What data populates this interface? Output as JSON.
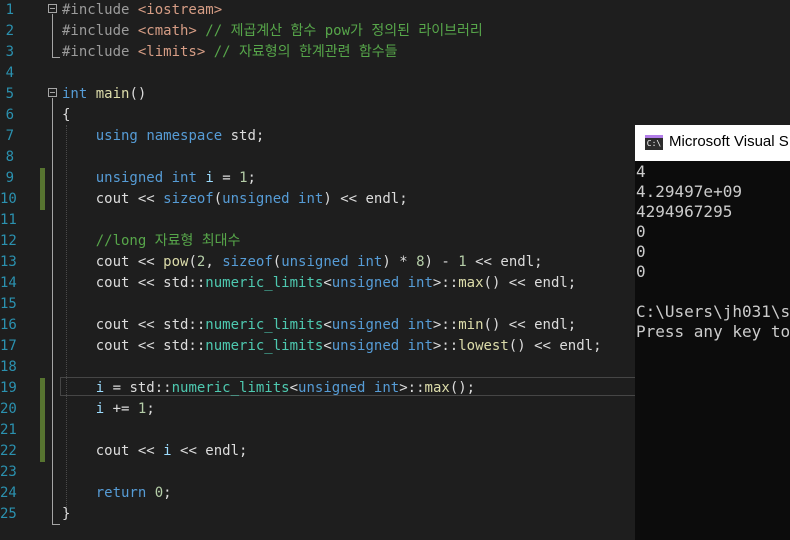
{
  "editor": {
    "line_numbers": [
      "1",
      "2",
      "3",
      "4",
      "5",
      "6",
      "7",
      "8",
      "9",
      "10",
      "11",
      "12",
      "13",
      "14",
      "15",
      "16",
      "17",
      "18",
      "19",
      "20",
      "21",
      "22",
      "23",
      "24",
      "25"
    ],
    "lines": [
      [
        {
          "t": "#include ",
          "c": "pp"
        },
        {
          "t": "<iostream>",
          "c": "str"
        }
      ],
      [
        {
          "t": "#include ",
          "c": "pp"
        },
        {
          "t": "<cmath>",
          "c": "str"
        },
        {
          "t": " // 제곱계산 함수 pow가 정의된 라이브러리",
          "c": "cm"
        }
      ],
      [
        {
          "t": "#include ",
          "c": "pp"
        },
        {
          "t": "<limits>",
          "c": "str"
        },
        {
          "t": " // 자료형의 한계관련 함수들",
          "c": "cm"
        }
      ],
      [],
      [
        {
          "t": "int",
          "c": "kw"
        },
        {
          "t": " "
        },
        {
          "t": "main",
          "c": "fn"
        },
        {
          "t": "()"
        }
      ],
      [
        {
          "t": "{"
        }
      ],
      [
        {
          "t": "    "
        },
        {
          "t": "using",
          "c": "kw"
        },
        {
          "t": " "
        },
        {
          "t": "namespace",
          "c": "kw"
        },
        {
          "t": " std;"
        }
      ],
      [],
      [
        {
          "t": "    "
        },
        {
          "t": "unsigned",
          "c": "kw"
        },
        {
          "t": " "
        },
        {
          "t": "int",
          "c": "kw"
        },
        {
          "t": " "
        },
        {
          "t": "i",
          "c": "var"
        },
        {
          "t": " = "
        },
        {
          "t": "1",
          "c": "num"
        },
        {
          "t": ";"
        }
      ],
      [
        {
          "t": "    cout << "
        },
        {
          "t": "sizeof",
          "c": "kw"
        },
        {
          "t": "("
        },
        {
          "t": "unsigned",
          "c": "kw"
        },
        {
          "t": " "
        },
        {
          "t": "int",
          "c": "kw"
        },
        {
          "t": ") << endl;"
        }
      ],
      [],
      [
        {
          "t": "    "
        },
        {
          "t": "//long 자료형 최대수",
          "c": "cm"
        }
      ],
      [
        {
          "t": "    cout << "
        },
        {
          "t": "pow",
          "c": "fn"
        },
        {
          "t": "("
        },
        {
          "t": "2",
          "c": "num"
        },
        {
          "t": ", "
        },
        {
          "t": "sizeof",
          "c": "kw"
        },
        {
          "t": "("
        },
        {
          "t": "unsigned",
          "c": "kw"
        },
        {
          "t": " "
        },
        {
          "t": "int",
          "c": "kw"
        },
        {
          "t": ") * "
        },
        {
          "t": "8",
          "c": "num"
        },
        {
          "t": ") - "
        },
        {
          "t": "1",
          "c": "num"
        },
        {
          "t": " << endl;"
        }
      ],
      [
        {
          "t": "    cout << std::"
        },
        {
          "t": "numeric_limits",
          "c": "ty"
        },
        {
          "t": "<"
        },
        {
          "t": "unsigned",
          "c": "kw"
        },
        {
          "t": " "
        },
        {
          "t": "int",
          "c": "kw"
        },
        {
          "t": ">::"
        },
        {
          "t": "max",
          "c": "fn"
        },
        {
          "t": "() << endl;"
        }
      ],
      [],
      [
        {
          "t": "    cout << std::"
        },
        {
          "t": "numeric_limits",
          "c": "ty"
        },
        {
          "t": "<"
        },
        {
          "t": "unsigned",
          "c": "kw"
        },
        {
          "t": " "
        },
        {
          "t": "int",
          "c": "kw"
        },
        {
          "t": ">::"
        },
        {
          "t": "min",
          "c": "fn"
        },
        {
          "t": "() << endl;"
        }
      ],
      [
        {
          "t": "    cout << std::"
        },
        {
          "t": "numeric_limits",
          "c": "ty"
        },
        {
          "t": "<"
        },
        {
          "t": "unsigned",
          "c": "kw"
        },
        {
          "t": " "
        },
        {
          "t": "int",
          "c": "kw"
        },
        {
          "t": ">::"
        },
        {
          "t": "lowest",
          "c": "fn"
        },
        {
          "t": "() << endl;"
        }
      ],
      [],
      [
        {
          "t": "    "
        },
        {
          "t": "i",
          "c": "var"
        },
        {
          "t": " = std::"
        },
        {
          "t": "numeric_limits",
          "c": "ty"
        },
        {
          "t": "<"
        },
        {
          "t": "unsigned",
          "c": "kw"
        },
        {
          "t": " "
        },
        {
          "t": "int",
          "c": "kw"
        },
        {
          "t": ">::"
        },
        {
          "t": "max",
          "c": "fn"
        },
        {
          "t": "();"
        }
      ],
      [
        {
          "t": "    "
        },
        {
          "t": "i",
          "c": "var"
        },
        {
          "t": " += "
        },
        {
          "t": "1",
          "c": "num"
        },
        {
          "t": ";"
        }
      ],
      [],
      [
        {
          "t": "    cout << "
        },
        {
          "t": "i",
          "c": "var"
        },
        {
          "t": " << endl;"
        }
      ],
      [],
      [
        {
          "t": "    "
        },
        {
          "t": "return",
          "c": "kw"
        },
        {
          "t": " "
        },
        {
          "t": "0",
          "c": "num"
        },
        {
          "t": ";"
        }
      ],
      [
        {
          "t": "}"
        }
      ]
    ]
  },
  "console": {
    "title": "Microsoft Visual S",
    "icon_label": "C:\\",
    "output": [
      "4",
      "4.29497e+09",
      "4294967295",
      "0",
      "0",
      "0",
      "",
      "C:\\Users\\jh031\\s",
      "Press any key to"
    ]
  },
  "colors": {
    "editor_bg": "#1e1e1e",
    "line_number": "#2b91af",
    "keyword": "#569cd6",
    "string": "#d69d85",
    "comment": "#57a64a",
    "number": "#b5cea8",
    "function": "#dcdcaa",
    "type": "#4ec9b0",
    "console_bg": "#0c0c0c",
    "change_bar": "#577430"
  }
}
